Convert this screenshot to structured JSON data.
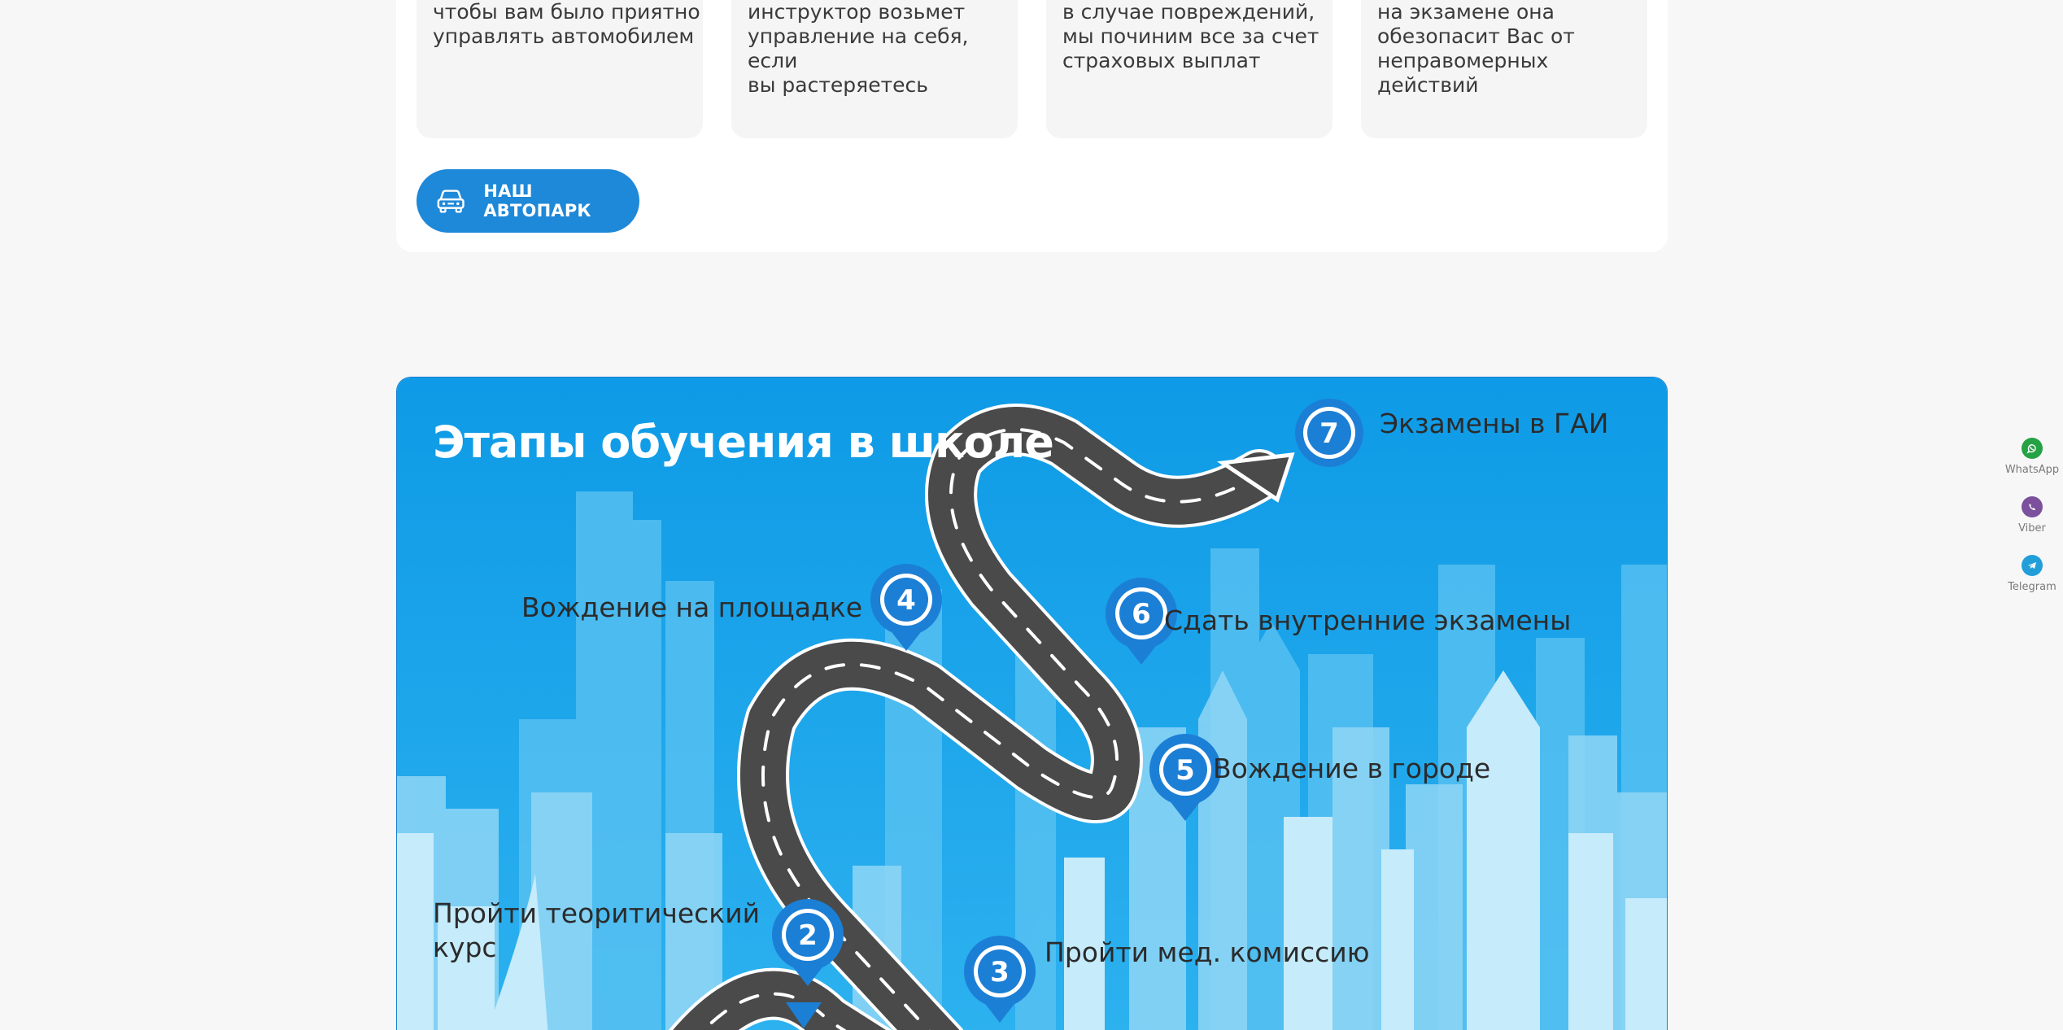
{
  "features": [
    {
      "text": "чтобы вам было приятно\nуправлять автомобилем"
    },
    {
      "text": "инструктор возьмет\nуправление на себя, если\nвы растеряетесь"
    },
    {
      "text": "в случае повреждений,\nмы починим все за счет\nстраховых выплат"
    },
    {
      "text": "на экзамене она\nобезопасит Вас от\nнеправомерных действий"
    }
  ],
  "fleet_button": {
    "label": "НАШ АВТОПАРК",
    "icon": "car-icon"
  },
  "stages": {
    "title": "Этапы обучения в школе",
    "steps": [
      {
        "number": "2",
        "label": "Пройти теоритический\nкурс"
      },
      {
        "number": "3",
        "label": "Пройти мед. комиссию"
      },
      {
        "number": "4",
        "label": "Вождение на площадке"
      },
      {
        "number": "5",
        "label": "Вождение в городе"
      },
      {
        "number": "6",
        "label": "Сдать внутренние экзамены"
      },
      {
        "number": "7",
        "label": "Экзамены в ГАИ"
      }
    ]
  },
  "messengers": [
    {
      "name": "WhatsApp",
      "color": "#25a244",
      "icon": "whatsapp-icon"
    },
    {
      "name": "Viber",
      "color": "#7b519d",
      "icon": "viber-icon"
    },
    {
      "name": "Telegram",
      "color": "#229ed9",
      "icon": "telegram-icon"
    }
  ],
  "colors": {
    "accent": "#1e88d9",
    "sky": "#1aa3e8"
  }
}
